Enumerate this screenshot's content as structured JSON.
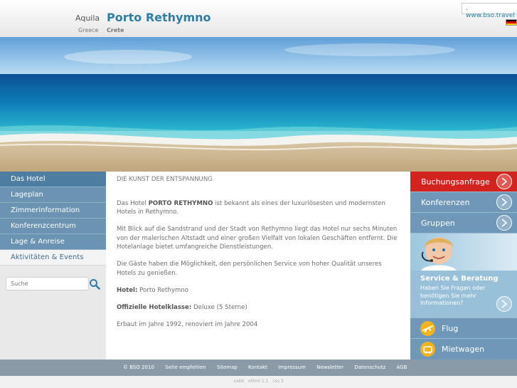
{
  "header": {
    "brand": "Aquila",
    "brand_country": "Greece",
    "hotel_name": "Porto Rethymno",
    "region": "Crete",
    "bso_link": ". www.bso.travel",
    "flag_icon": "german-flag-icon",
    "flag_colors": [
      "#000000",
      "#dd0000",
      "#ffce00"
    ]
  },
  "hero": {
    "icon": "beach-photo"
  },
  "sidebar": {
    "items": [
      {
        "label": "Das Hotel",
        "active": true
      },
      {
        "label": "Lageplan"
      },
      {
        "label": "Zimmerinformation"
      },
      {
        "label": "Konferenzcentrum"
      },
      {
        "label": "Lage & Anreise"
      },
      {
        "label": "Aktivitäten & Events",
        "light": true
      }
    ],
    "search_placeholder": "Suche",
    "search_icon": "magnifier-icon"
  },
  "content": {
    "heading": "DIE KUNST DER ENTSPANNUNG",
    "p1_before": "Das Hotel ",
    "p1_bold": "PORTO RETHYMNO",
    "p1_after": " ist bekannt als eines der luxuriösesten und modernsten Hotels in Rethymno.",
    "p2": "Mit Blick auf die Sandstrand und der Stadt von Rethymno liegt das Hotel nur sechs Minuten von der malerischen Altstadt und einer großen Vielfalt von lokalen Geschäften entfernt. Die Hotelanlage bietet umfangreiche Dienstleistungen.",
    "p3": "Die Gäste haben die Möglichkeit, den persönlichen Service von hoher Qualität unseres Hotels zu genießen.",
    "hotel_label": "Hotel:",
    "hotel_value": " Porto Rethymno",
    "class_label": "Offizielle Hotelklasse:",
    "class_value": " Deluxe (5 Sterne)",
    "built": "Erbaut im Jahre 1992, renoviert im Jahre 2004"
  },
  "right": {
    "buttons": [
      {
        "label": "Buchungsanfrage",
        "color": "#d2231e"
      },
      {
        "label": "Konferenzen",
        "color": "#6f98b8"
      },
      {
        "label": "Gruppen",
        "color": "#6f98b8"
      }
    ],
    "service_title": "Service & Beratung",
    "service_text": "Haben Sie Fragen oder benötigen Sie mehr Informationen?",
    "links": [
      {
        "label": "Flug",
        "icon": "airplane-icon"
      },
      {
        "label": "Mietwagen",
        "icon": "car-icon"
      }
    ]
  },
  "footer": {
    "copyright": "© BSO 2010",
    "links": [
      "Seite empfehlen",
      "Sitemap",
      "Kontakt",
      "Impressum",
      "Newsletter",
      "Datenschutz",
      "AGB"
    ]
  },
  "validator": {
    "valid": "valid",
    "xhtml": "xhtml 1.1",
    "css": "css 3"
  }
}
